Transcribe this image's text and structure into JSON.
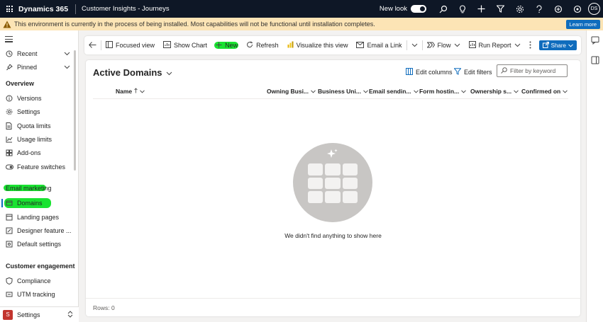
{
  "topbar": {
    "app_name": "Dynamics 365",
    "app_subtitle": "Customer Insights - Journeys",
    "new_look_label": "New look",
    "avatar_initials": "DS"
  },
  "banner": {
    "message": "This environment is currently in the process of being installed. Most capabilities will not be functional until installation completes.",
    "learn_more": "Learn more"
  },
  "sidebar": {
    "recent": "Recent",
    "pinned": "Pinned",
    "overview_heading": "Overview",
    "overview_items": [
      "Versions",
      "Settings",
      "Quota limits",
      "Usage limits",
      "Add-ons",
      "Feature switches"
    ],
    "email_heading": "Email marketing",
    "email_items": [
      "Domains",
      "Landing pages",
      "Designer feature ...",
      "Default settings"
    ],
    "engagement_heading": "Customer engagement",
    "engagement_items": [
      "Compliance",
      "UTM tracking"
    ],
    "area_badge": "S",
    "area_label": "Settings"
  },
  "commandbar": {
    "focused_view": "Focused view",
    "show_chart": "Show Chart",
    "new": "New",
    "refresh": "Refresh",
    "visualize": "Visualize this view",
    "email_link": "Email a Link",
    "flow": "Flow",
    "run_report": "Run Report",
    "share": "Share"
  },
  "view": {
    "title": "Active Domains",
    "edit_columns": "Edit columns",
    "edit_filters": "Edit filters",
    "filter_placeholder": "Filter by keyword",
    "columns": [
      "Name",
      "Owning Busi...",
      "Business Uni...",
      "Email sendin...",
      "Form hostin...",
      "Ownership s...",
      "Confirmed on"
    ],
    "empty_message": "We didn't find anything to show here",
    "rows_label": "Rows: 0"
  },
  "colors": {
    "topbar_bg": "#0e1726",
    "banner_bg": "#fce4b5",
    "accent": "#0f6cbd",
    "highlight": "#00e01b"
  }
}
